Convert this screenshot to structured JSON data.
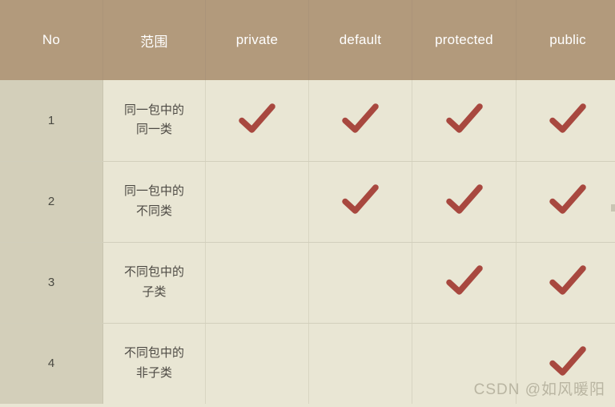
{
  "table": {
    "columns": [
      {
        "key": "no",
        "label": "No"
      },
      {
        "key": "scope",
        "label": "范围"
      },
      {
        "key": "private",
        "label": "private"
      },
      {
        "key": "default",
        "label": "default"
      },
      {
        "key": "protected",
        "label": "protected"
      },
      {
        "key": "public",
        "label": "public"
      }
    ],
    "rows": [
      {
        "no": "1",
        "scope": "同一包中的同一类",
        "private": "✔",
        "default": "✔",
        "protected": "✔",
        "public": "✔"
      },
      {
        "no": "2",
        "scope": "同一包中的不同类",
        "private": "",
        "default": "✔",
        "protected": "✔",
        "public": "✔"
      },
      {
        "no": "3",
        "scope": "不同包中的子类",
        "private": "",
        "default": "",
        "protected": "✔",
        "public": "✔"
      },
      {
        "no": "4",
        "scope": "不同包中的非子类",
        "private": "",
        "default": "",
        "protected": "",
        "public": "✔"
      }
    ]
  },
  "watermark": {
    "text": "CSDN @如风暖阳"
  },
  "colors": {
    "header_background": "#b29a7c",
    "header_text": "#ffffff",
    "body_background": "#e9e6d4",
    "no_column_background": "#d3cfba",
    "body_text": "#4e4b45",
    "checkmark": "#a8483f",
    "grid_line": "#d5d2bf",
    "watermark_text": "#b9b5a2"
  }
}
